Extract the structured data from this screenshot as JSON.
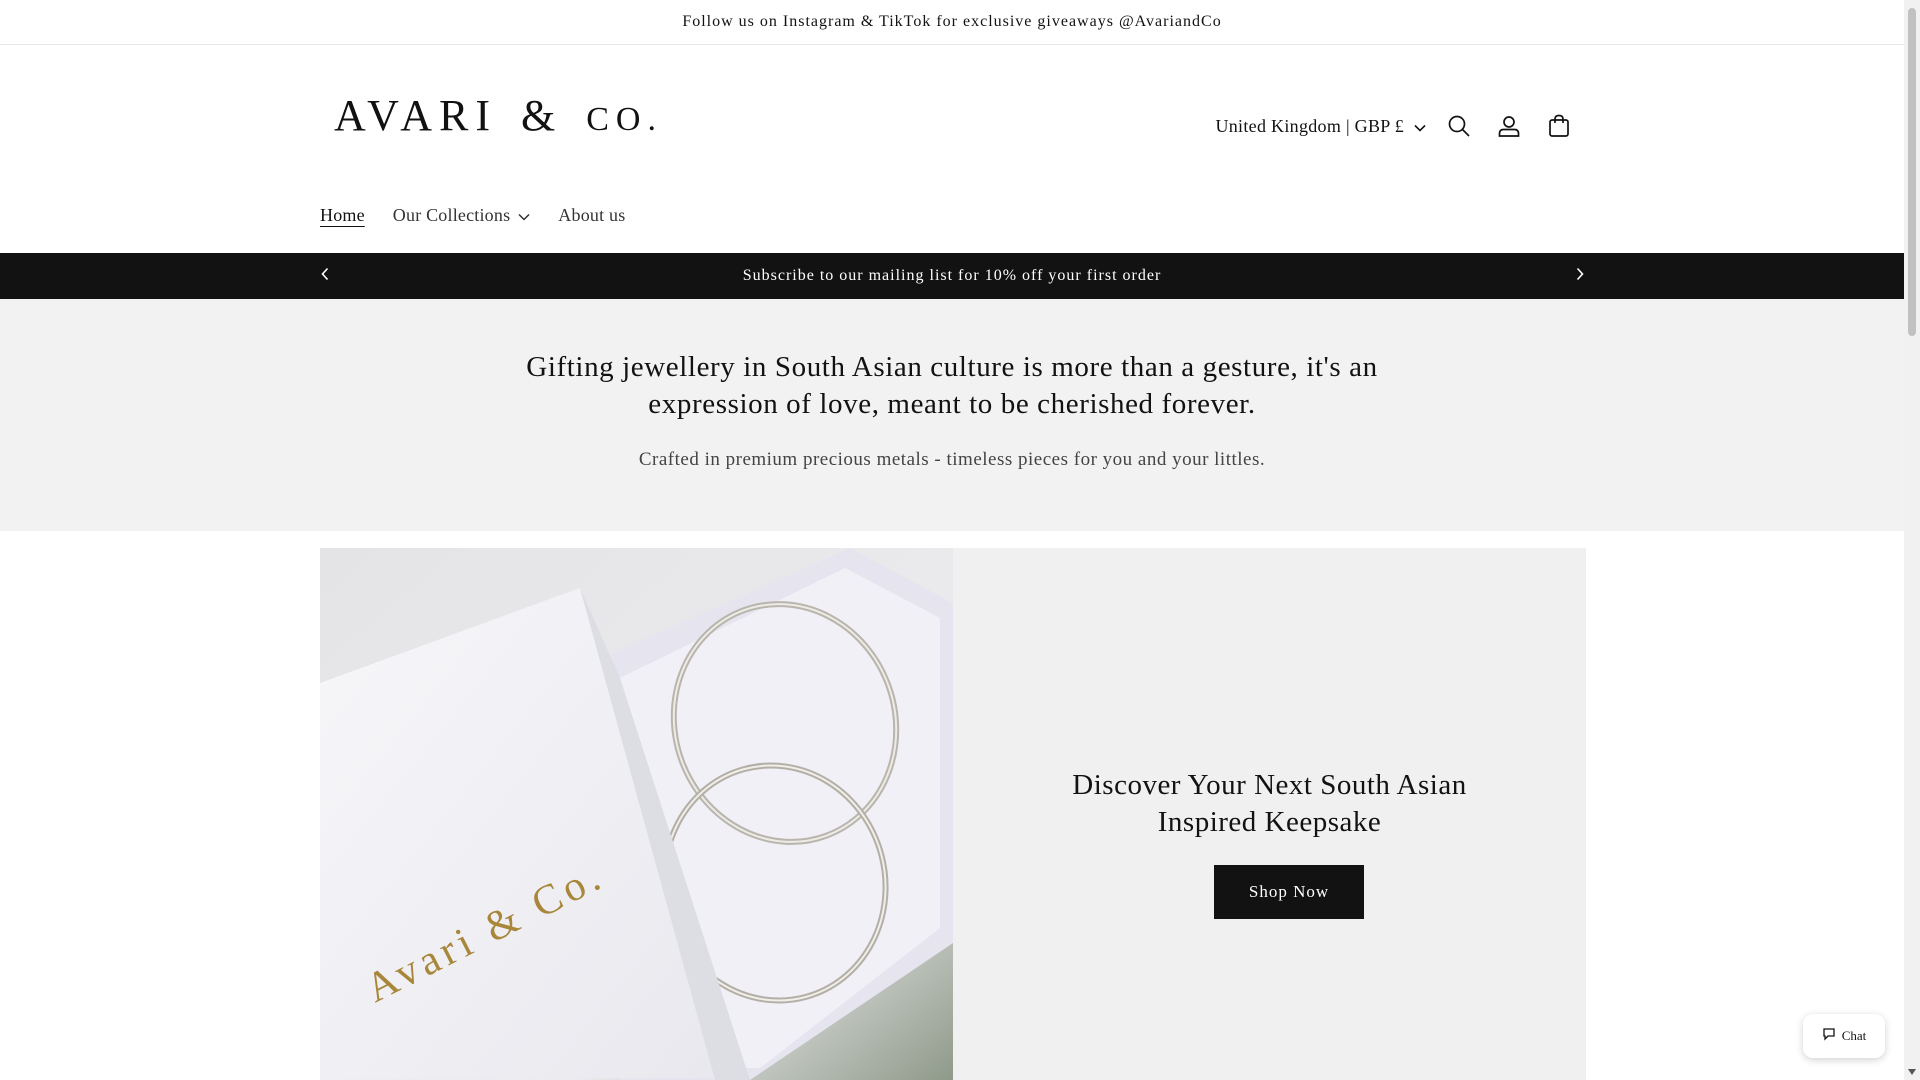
{
  "announcement": {
    "text": "Follow us on Instagram & TikTok for exclusive giveaways @AvariandCo"
  },
  "header": {
    "logo": {
      "main": "AVARI",
      "amp": "&",
      "co": "CO."
    },
    "country_selector": "United Kingdom | GBP £",
    "icons": [
      "search-icon",
      "account-icon",
      "cart-icon"
    ]
  },
  "nav": {
    "items": [
      {
        "label": "Home",
        "active": true
      },
      {
        "label": "Our Collections",
        "has_dropdown": true
      },
      {
        "label": "About us"
      }
    ]
  },
  "promo_bar": {
    "text": "Subscribe to our mailing list for 10% off your first order"
  },
  "intro": {
    "heading_line1": "Gifting jewellery in South Asian culture is more than a gesture, it's an",
    "heading_line2": "expression of love, meant to be cherished forever.",
    "subtext": "Crafted in premium precious metals - timeless pieces for you and your littles."
  },
  "feature": {
    "image_box_text": "Avari & Co.",
    "heading_line1": "Discover Your Next South Asian",
    "heading_line2": "Inspired Keepsake",
    "button_label": "Shop Now"
  },
  "chat": {
    "label": "Chat"
  },
  "colors": {
    "dark": "#121212",
    "light_bg": "#f2f2f2",
    "gold": "#a8863a"
  }
}
